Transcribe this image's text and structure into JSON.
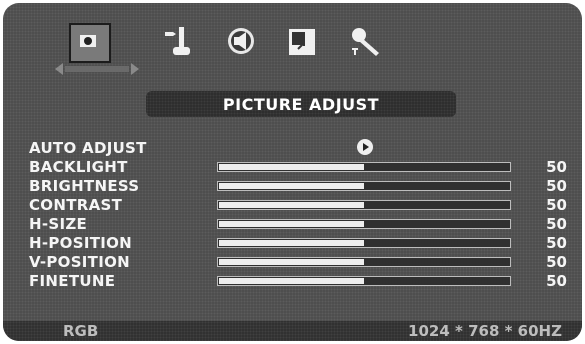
{
  "icon_tabs": [
    {
      "name": "picture-icon",
      "selected": true
    },
    {
      "name": "input-source-icon",
      "selected": false
    },
    {
      "name": "audio-icon",
      "selected": false
    },
    {
      "name": "pip-icon",
      "selected": false
    },
    {
      "name": "tools-icon",
      "selected": false
    }
  ],
  "header": {
    "title": "PICTURE ADJUST"
  },
  "menu": {
    "auto_adjust": {
      "label": "AUTO ADJUST"
    },
    "items": [
      {
        "label": "BACKLIGHT",
        "value": "50",
        "level": 0.5
      },
      {
        "label": "BRIGHTNESS",
        "value": "50",
        "level": 0.5
      },
      {
        "label": "CONTRAST",
        "value": "50",
        "level": 0.5
      },
      {
        "label": "H-SIZE",
        "value": "50",
        "level": 0.5
      },
      {
        "label": "H-POSITION",
        "value": "50",
        "level": 0.5
      },
      {
        "label": "V-POSITION",
        "value": "50",
        "level": 0.5
      },
      {
        "label": "FINETUNE",
        "value": "50",
        "level": 0.5
      }
    ]
  },
  "status": {
    "input": "RGB",
    "resolution": "1024 * 768 * 60HZ"
  },
  "colors": {
    "panel": "#4a4a4a",
    "bar": "#2b2b2b",
    "text": "#f5f5f5",
    "slider_fill": "#eeeeee"
  }
}
